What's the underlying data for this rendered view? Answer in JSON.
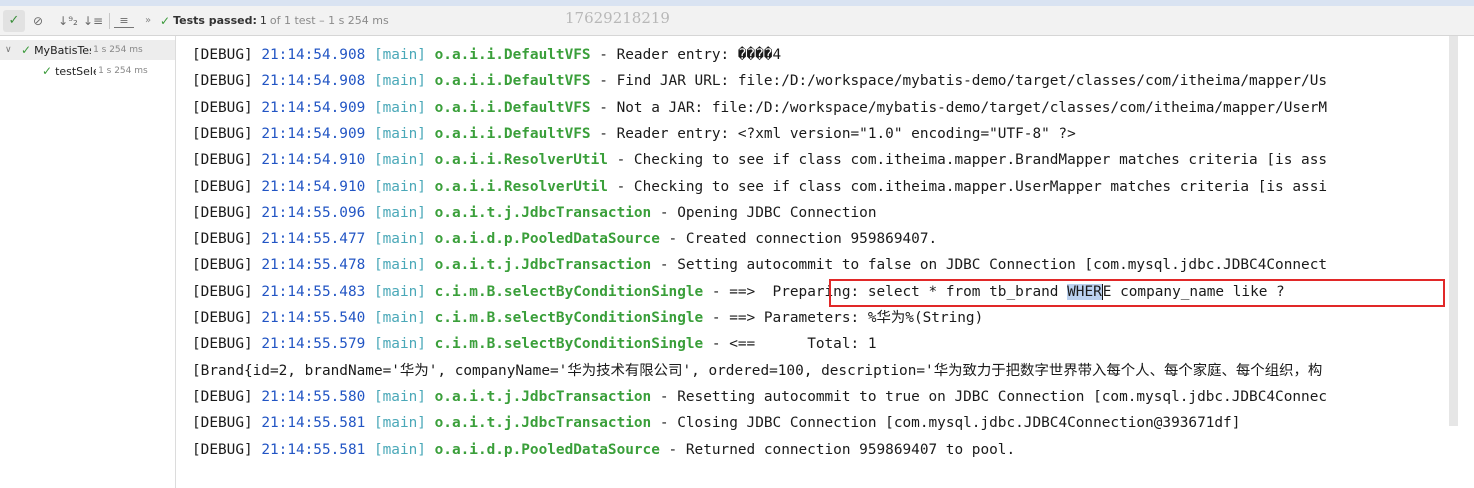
{
  "toolbar": {
    "check_icon": "✓",
    "ban_icon": "⊘",
    "sort_numeric_icon": "↓⁹₂",
    "sort_alpha_icon": "↓≡",
    "expand_icon": "≡",
    "more_icon": "»",
    "status_icon": "✓",
    "status_label": "Tests passed:",
    "status_count": "1",
    "status_rest": "of 1 test – 1 s 254 ms"
  },
  "watermark": "17629218219",
  "tree": {
    "suite": {
      "name": "MyBatisTes",
      "time": "1 s 254 ms"
    },
    "test": {
      "name": "testSele",
      "time": "1 s 254 ms"
    }
  },
  "log_lines": [
    {
      "level": "[DEBUG]",
      "time": "21:14:54.908",
      "thread": "[main]",
      "logger": "o.a.i.i.DefaultVFS",
      "sep": " - ",
      "message": "Reader entry: ����4"
    },
    {
      "level": "[DEBUG]",
      "time": "21:14:54.908",
      "thread": "[main]",
      "logger": "o.a.i.i.DefaultVFS",
      "sep": " - ",
      "message": "Find JAR URL: file:/D:/workspace/mybatis-demo/target/classes/com/itheima/mapper/Us"
    },
    {
      "level": "[DEBUG]",
      "time": "21:14:54.909",
      "thread": "[main]",
      "logger": "o.a.i.i.DefaultVFS",
      "sep": " - ",
      "message": "Not a JAR: file:/D:/workspace/mybatis-demo/target/classes/com/itheima/mapper/UserM"
    },
    {
      "level": "[DEBUG]",
      "time": "21:14:54.909",
      "thread": "[main]",
      "logger": "o.a.i.i.DefaultVFS",
      "sep": " - ",
      "message": "Reader entry: <?xml version=\"1.0\" encoding=\"UTF-8\" ?>"
    },
    {
      "level": "[DEBUG]",
      "time": "21:14:54.910",
      "thread": "[main]",
      "logger": "o.a.i.i.ResolverUtil",
      "sep": " - ",
      "message": "Checking to see if class com.itheima.mapper.BrandMapper matches criteria [is ass"
    },
    {
      "level": "[DEBUG]",
      "time": "21:14:54.910",
      "thread": "[main]",
      "logger": "o.a.i.i.ResolverUtil",
      "sep": " - ",
      "message": "Checking to see if class com.itheima.mapper.UserMapper matches criteria [is assi"
    },
    {
      "level": "[DEBUG]",
      "time": "21:14:55.096",
      "thread": "[main]",
      "logger": "o.a.i.t.j.JdbcTransaction",
      "sep": " - ",
      "message": "Opening JDBC Connection"
    },
    {
      "level": "[DEBUG]",
      "time": "21:14:55.477",
      "thread": "[main]",
      "logger": "o.a.i.d.p.PooledDataSource",
      "sep": " - ",
      "message": "Created connection 959869407."
    },
    {
      "level": "[DEBUG]",
      "time": "21:14:55.478",
      "thread": "[main]",
      "logger": "o.a.i.t.j.JdbcTransaction",
      "sep": " - ",
      "message": "Setting autocommit to false on JDBC Connection [com.mysql.jdbc.JDBC4Connect"
    },
    {
      "level": "[DEBUG]",
      "time": "21:14:55.483",
      "thread": "[main]",
      "logger": "c.i.m.B.selectByConditionSingle",
      "sep": " - ",
      "message_a": "==>  Preparing: select * from tb_brand ",
      "message_hl": "WHER",
      "message_b": "E company_name like ?"
    },
    {
      "level": "[DEBUG]",
      "time": "21:14:55.540",
      "thread": "[main]",
      "logger": "c.i.m.B.selectByConditionSingle",
      "sep": " - ",
      "message": "==> Parameters: %华为%(String)"
    },
    {
      "level": "[DEBUG]",
      "time": "21:14:55.579",
      "thread": "[main]",
      "logger": "c.i.m.B.selectByConditionSingle",
      "sep": " - ",
      "message": "<==      Total: 1"
    },
    {
      "plain": "[Brand{id=2, brandName='华为', companyName='华为技术有限公司', ordered=100, description='华为致力于把数字世界带入每个人、每个家庭、每个组织，构"
    },
    {
      "level": "[DEBUG]",
      "time": "21:14:55.580",
      "thread": "[main]",
      "logger": "o.a.i.t.j.JdbcTransaction",
      "sep": " - ",
      "message": "Resetting autocommit to true on JDBC Connection [com.mysql.jdbc.JDBC4Connec"
    },
    {
      "level": "[DEBUG]",
      "time": "21:14:55.581",
      "thread": "[main]",
      "logger": "o.a.i.t.j.JdbcTransaction",
      "sep": " - ",
      "message": "Closing JDBC Connection [com.mysql.jdbc.JDBC4Connection@393671df]"
    },
    {
      "level": "[DEBUG]",
      "time": "21:14:55.581",
      "thread": "[main]",
      "logger": "o.a.i.d.p.PooledDataSource",
      "sep": " - ",
      "message": "Returned connection 959869407 to pool."
    }
  ],
  "colors": {
    "timestamp": "#2255c4",
    "thread": "#4aa8b8",
    "logger": "#3a9f3a",
    "highlight_box": "#e12828",
    "pass": "#3b9a3b"
  }
}
